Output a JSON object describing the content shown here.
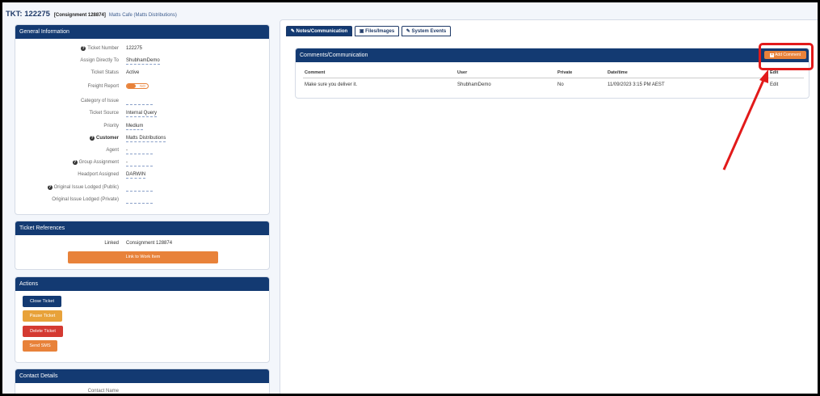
{
  "header": {
    "ticket": "TKT: 122275",
    "consignment": "Consignment 128874",
    "customer": "Matts Cafe (Matts Distributions)"
  },
  "general": {
    "title": "General Information",
    "fields": [
      {
        "label": "Ticket Number",
        "value": "122275",
        "help": true
      },
      {
        "label": "Assign Directly To",
        "value": "ShubhamDemo"
      },
      {
        "label": "Ticket Status",
        "value": "Active"
      },
      {
        "label": "Freight Report",
        "value": "NO"
      },
      {
        "label": "Category of Issue",
        "value": ""
      },
      {
        "label": "Ticket Source",
        "value": "Internal Query"
      },
      {
        "label": "Priority",
        "value": "Medium"
      },
      {
        "label": "Customer",
        "value": "Matts Distributions",
        "help": true
      },
      {
        "label": "Agent",
        "value": "-"
      },
      {
        "label": "Group Assignment",
        "value": "-",
        "help": true
      },
      {
        "label": "Headport Assigned",
        "value": "DARWIN"
      },
      {
        "label": "Original Issue Lodged (Public)",
        "value": "",
        "help": true
      },
      {
        "label": "Original Issue Lodged (Private)",
        "value": ""
      }
    ]
  },
  "references": {
    "title": "Ticket References",
    "linked_label": "Linked",
    "linked_value": "Consignment 128874",
    "link_button": "Link to Work Item"
  },
  "actions": {
    "title": "Actions",
    "close": "Close Ticket",
    "pause": "Pause Ticket",
    "delete": "Delete Ticket",
    "sms": "Send SMS"
  },
  "contact": {
    "title": "Contact Details",
    "name_label": "Contact Name"
  },
  "tabs": [
    "Notes/Communication",
    "Files/Images",
    "System Events"
  ],
  "comments": {
    "title": "Comments/Communication",
    "add_button": "Add Comment",
    "columns": [
      "Comment",
      "User",
      "Private",
      "Date/time",
      "Edit"
    ],
    "rows": [
      {
        "comment": "Make sure you deliver it.",
        "user": "ShubhamDemo",
        "private": "No",
        "datetime": "11/09/2023 3:15 PM AEST",
        "edit": "Edit"
      }
    ]
  },
  "colors": {
    "navy": "#133a72",
    "orange": "#e8823a",
    "pause": "#e8a23a",
    "red": "#d43a32",
    "annotation": "#e21a1a"
  }
}
